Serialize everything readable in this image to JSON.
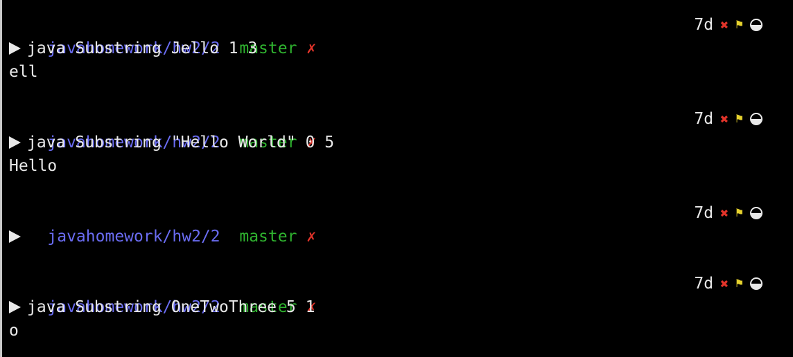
{
  "blocks": [
    {
      "path": "javahomework/hw2/2",
      "branch": "master",
      "dirty_mark": "✗",
      "age": "7d",
      "command": "java Substring Jello 1 3",
      "output": "ell"
    },
    {
      "path": "javahomework/hw2/2",
      "branch": "master",
      "dirty_mark": "✗",
      "age": "7d",
      "command": "java Substring \"Hello World\" 0 5",
      "output": "Hello"
    },
    {
      "path": "javahomework/hw2/2",
      "branch": "master",
      "dirty_mark": "✗",
      "age": "7d",
      "command": "",
      "output": ""
    },
    {
      "path": "javahomework/hw2/2",
      "branch": "master",
      "dirty_mark": "✗",
      "age": "7d",
      "command": "java Substring OneTwoThree 5 1",
      "output": "o"
    }
  ],
  "status_icons": [
    "x-icon",
    "flag-icon",
    "half-circle-icon"
  ],
  "colors": {
    "path": "#6a6cf2",
    "branch": "#2fb32f",
    "dirty": "#e3342a",
    "flag": "#e6d22e",
    "text": "#e8e8e8",
    "background": "#000000"
  }
}
